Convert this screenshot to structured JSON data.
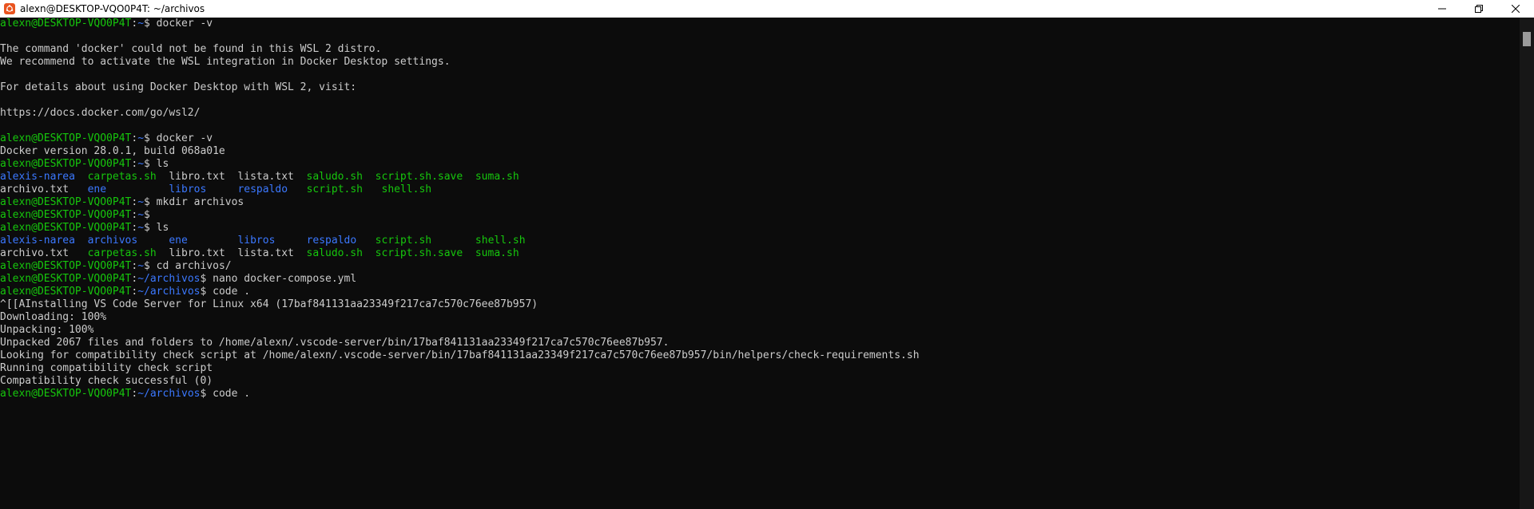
{
  "window": {
    "title": "alexn@DESKTOP-VQO0P4T: ~/archivos",
    "controls": {
      "minimize_icon": "minimize-icon",
      "maximize_icon": "restore-icon",
      "close_icon": "close-icon"
    }
  },
  "colors": {
    "background": "#0c0c0c",
    "text": "#cccccc",
    "prompt_user": "#16c60c",
    "prompt_path": "#3b78ff",
    "directory": "#3b78ff",
    "executable": "#16c60c"
  },
  "terminal": {
    "lines": [
      [
        {
          "t": "alexn@DESKTOP-VQO0P4T",
          "c": "user"
        },
        {
          "t": ":",
          "c": "plain"
        },
        {
          "t": "~",
          "c": "path"
        },
        {
          "t": "$ docker -v",
          "c": "plain"
        }
      ],
      [],
      [
        {
          "t": "The command 'docker' could not be found in this WSL 2 distro.",
          "c": "plain"
        }
      ],
      [
        {
          "t": "We recommend to activate the WSL integration in Docker Desktop settings.",
          "c": "plain"
        }
      ],
      [],
      [
        {
          "t": "For details about using Docker Desktop with WSL 2, visit:",
          "c": "plain"
        }
      ],
      [],
      [
        {
          "t": "https://docs.docker.com/go/wsl2/",
          "c": "plain"
        }
      ],
      [],
      [
        {
          "t": "alexn@DESKTOP-VQO0P4T",
          "c": "user"
        },
        {
          "t": ":",
          "c": "plain"
        },
        {
          "t": "~",
          "c": "path"
        },
        {
          "t": "$ docker -v",
          "c": "plain"
        }
      ],
      [
        {
          "t": "Docker version 28.0.1, build 068a01e",
          "c": "plain"
        }
      ],
      [
        {
          "t": "alexn@DESKTOP-VQO0P4T",
          "c": "user"
        },
        {
          "t": ":",
          "c": "plain"
        },
        {
          "t": "~",
          "c": "path"
        },
        {
          "t": "$ ls",
          "c": "plain"
        }
      ],
      [
        {
          "t": "alexis-narea",
          "c": "dir"
        },
        {
          "t": "  ",
          "c": "plain"
        },
        {
          "t": "carpetas.sh",
          "c": "exe"
        },
        {
          "t": "  libro.txt  lista.txt  ",
          "c": "plain"
        },
        {
          "t": "saludo.sh",
          "c": "exe"
        },
        {
          "t": "  ",
          "c": "plain"
        },
        {
          "t": "script.sh.save",
          "c": "exe"
        },
        {
          "t": "  ",
          "c": "plain"
        },
        {
          "t": "suma.sh",
          "c": "exe"
        }
      ],
      [
        {
          "t": "archivo.txt   ",
          "c": "plain"
        },
        {
          "t": "ene",
          "c": "dir"
        },
        {
          "t": "          ",
          "c": "plain"
        },
        {
          "t": "libros",
          "c": "dir"
        },
        {
          "t": "     ",
          "c": "plain"
        },
        {
          "t": "respaldo",
          "c": "dir"
        },
        {
          "t": "   ",
          "c": "plain"
        },
        {
          "t": "script.sh",
          "c": "exe"
        },
        {
          "t": "   ",
          "c": "plain"
        },
        {
          "t": "shell.sh",
          "c": "exe"
        }
      ],
      [
        {
          "t": "alexn@DESKTOP-VQO0P4T",
          "c": "user"
        },
        {
          "t": ":",
          "c": "plain"
        },
        {
          "t": "~",
          "c": "path"
        },
        {
          "t": "$ mkdir archivos",
          "c": "plain"
        }
      ],
      [
        {
          "t": "alexn@DESKTOP-VQO0P4T",
          "c": "user"
        },
        {
          "t": ":",
          "c": "plain"
        },
        {
          "t": "~",
          "c": "path"
        },
        {
          "t": "$",
          "c": "plain"
        }
      ],
      [
        {
          "t": "alexn@DESKTOP-VQO0P4T",
          "c": "user"
        },
        {
          "t": ":",
          "c": "plain"
        },
        {
          "t": "~",
          "c": "path"
        },
        {
          "t": "$ ls",
          "c": "plain"
        }
      ],
      [
        {
          "t": "alexis-narea",
          "c": "dir"
        },
        {
          "t": "  ",
          "c": "plain"
        },
        {
          "t": "archivos",
          "c": "dir"
        },
        {
          "t": "     ",
          "c": "plain"
        },
        {
          "t": "ene",
          "c": "dir"
        },
        {
          "t": "        ",
          "c": "plain"
        },
        {
          "t": "libros",
          "c": "dir"
        },
        {
          "t": "     ",
          "c": "plain"
        },
        {
          "t": "respaldo",
          "c": "dir"
        },
        {
          "t": "   ",
          "c": "plain"
        },
        {
          "t": "script.sh",
          "c": "exe"
        },
        {
          "t": "       ",
          "c": "plain"
        },
        {
          "t": "shell.sh",
          "c": "exe"
        }
      ],
      [
        {
          "t": "archivo.txt   ",
          "c": "plain"
        },
        {
          "t": "carpetas.sh",
          "c": "exe"
        },
        {
          "t": "  libro.txt  lista.txt  ",
          "c": "plain"
        },
        {
          "t": "saludo.sh",
          "c": "exe"
        },
        {
          "t": "  ",
          "c": "plain"
        },
        {
          "t": "script.sh.save",
          "c": "exe"
        },
        {
          "t": "  ",
          "c": "plain"
        },
        {
          "t": "suma.sh",
          "c": "exe"
        }
      ],
      [
        {
          "t": "alexn@DESKTOP-VQO0P4T",
          "c": "user"
        },
        {
          "t": ":",
          "c": "plain"
        },
        {
          "t": "~",
          "c": "path"
        },
        {
          "t": "$ cd archivos/",
          "c": "plain"
        }
      ],
      [
        {
          "t": "alexn@DESKTOP-VQO0P4T",
          "c": "user"
        },
        {
          "t": ":",
          "c": "plain"
        },
        {
          "t": "~/archivos",
          "c": "path"
        },
        {
          "t": "$ nano docker-compose.yml",
          "c": "plain"
        }
      ],
      [
        {
          "t": "alexn@DESKTOP-VQO0P4T",
          "c": "user"
        },
        {
          "t": ":",
          "c": "plain"
        },
        {
          "t": "~/archivos",
          "c": "path"
        },
        {
          "t": "$ code .",
          "c": "plain"
        }
      ],
      [
        {
          "t": "^[[AInstalling VS Code Server for Linux x64 (17baf841131aa23349f217ca7c570c76ee87b957)",
          "c": "plain"
        }
      ],
      [
        {
          "t": "Downloading: 100%",
          "c": "plain"
        }
      ],
      [
        {
          "t": "Unpacking: 100%",
          "c": "plain"
        }
      ],
      [
        {
          "t": "Unpacked 2067 files and folders to /home/alexn/.vscode-server/bin/17baf841131aa23349f217ca7c570c76ee87b957.",
          "c": "plain"
        }
      ],
      [
        {
          "t": "Looking for compatibility check script at /home/alexn/.vscode-server/bin/17baf841131aa23349f217ca7c570c76ee87b957/bin/helpers/check-requirements.sh",
          "c": "plain"
        }
      ],
      [
        {
          "t": "Running compatibility check script",
          "c": "plain"
        }
      ],
      [
        {
          "t": "Compatibility check successful (0)",
          "c": "plain"
        }
      ],
      [
        {
          "t": "alexn@DESKTOP-VQO0P4T",
          "c": "user"
        },
        {
          "t": ":",
          "c": "plain"
        },
        {
          "t": "~/archivos",
          "c": "path"
        },
        {
          "t": "$ code .",
          "c": "plain"
        }
      ]
    ]
  }
}
